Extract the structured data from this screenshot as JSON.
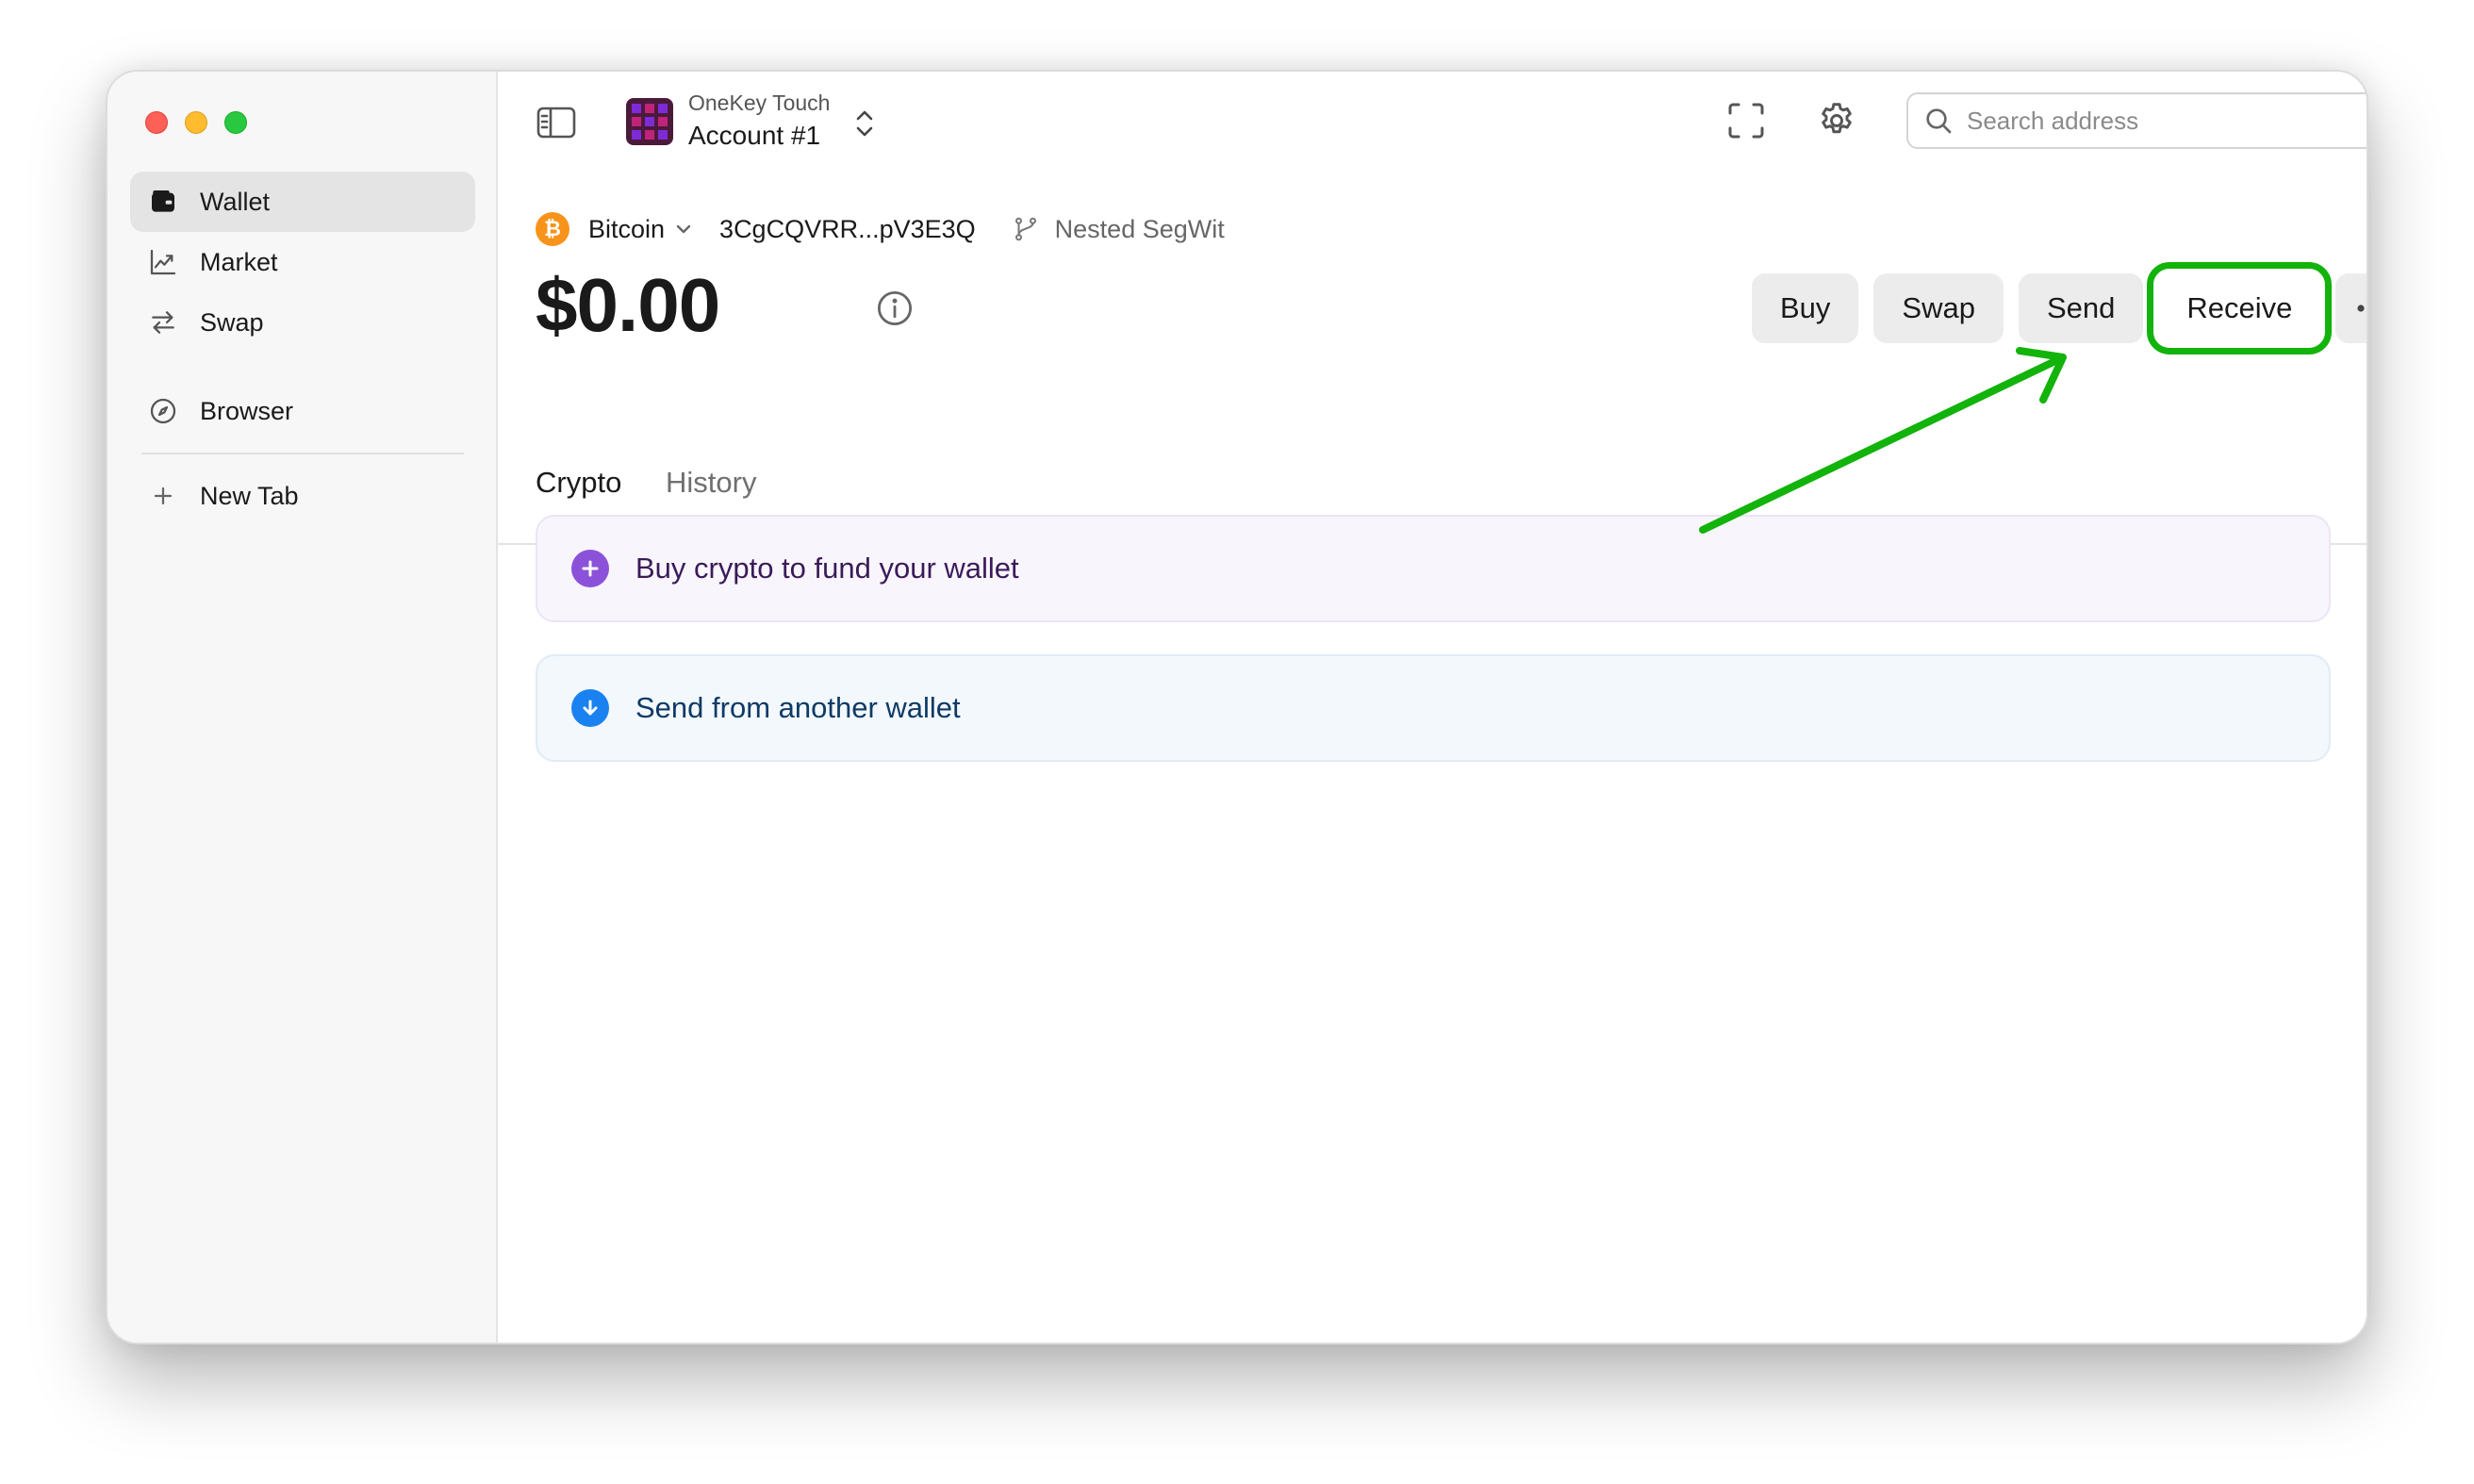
{
  "sidebar": {
    "items": [
      {
        "label": "Wallet",
        "icon": "wallet-icon",
        "active": true
      },
      {
        "label": "Market",
        "icon": "chart-icon",
        "active": false
      },
      {
        "label": "Swap",
        "icon": "swap-icon",
        "active": false
      },
      {
        "label": "Browser",
        "icon": "compass-icon",
        "active": false
      }
    ],
    "new_tab_label": "New Tab"
  },
  "header": {
    "device_name": "OneKey Touch",
    "account_name": "Account #1",
    "search_placeholder": "Search address"
  },
  "network": {
    "name": "Bitcoin",
    "address": "3CgCQVRR...pV3E3Q",
    "derivation": "Nested SegWit"
  },
  "balance": "$0.00",
  "actions": {
    "buy": "Buy",
    "swap": "Swap",
    "send": "Send",
    "receive": "Receive"
  },
  "tabs": [
    {
      "label": "Crypto",
      "active": true
    },
    {
      "label": "History",
      "active": false
    }
  ],
  "cards": {
    "buy": "Buy crypto to fund your wallet",
    "send": "Send from another wallet"
  },
  "colors": {
    "highlight": "#12b30a",
    "bitcoin": "#f7931a",
    "buy_card_icon": "#8b52d9",
    "send_card_icon": "#1a82f0"
  }
}
